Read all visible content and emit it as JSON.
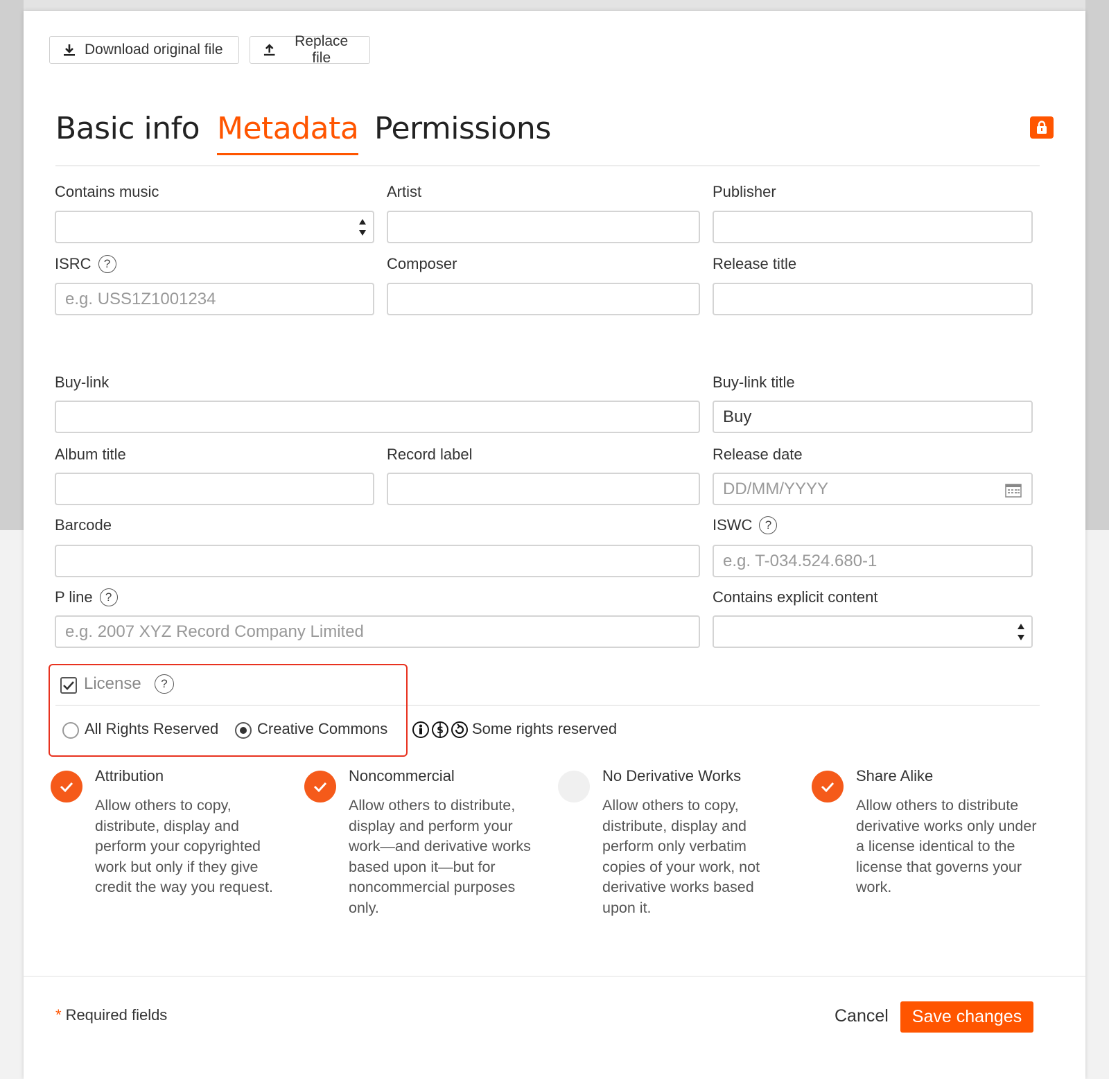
{
  "top_buttons": {
    "download": "Download original file",
    "replace": "Replace file"
  },
  "tabs": [
    {
      "label": "Basic info",
      "active": false
    },
    {
      "label": "Metadata",
      "active": true
    },
    {
      "label": "Permissions",
      "active": false
    }
  ],
  "fields": {
    "contains_music": {
      "label": "Contains music",
      "value": ""
    },
    "artist": {
      "label": "Artist",
      "value": ""
    },
    "publisher": {
      "label": "Publisher",
      "value": ""
    },
    "isrc": {
      "label": "ISRC",
      "help": "?",
      "placeholder": "e.g. USS1Z1001234",
      "value": ""
    },
    "composer": {
      "label": "Composer",
      "value": ""
    },
    "release_title": {
      "label": "Release title",
      "value": ""
    },
    "buy_link": {
      "label": "Buy-link",
      "value": ""
    },
    "buy_link_title": {
      "label": "Buy-link title",
      "value": "Buy"
    },
    "album_title": {
      "label": "Album title",
      "value": ""
    },
    "record_label": {
      "label": "Record label",
      "value": ""
    },
    "release_date": {
      "label": "Release date",
      "placeholder": "DD/MM/YYYY",
      "value": ""
    },
    "barcode": {
      "label": "Barcode",
      "value": ""
    },
    "iswc": {
      "label": "ISWC",
      "help": "?",
      "placeholder": "e.g. T-034.524.680-1",
      "value": ""
    },
    "p_line": {
      "label": "P line",
      "help": "?",
      "placeholder": "e.g. 2007 XYZ Record Company Limited",
      "value": ""
    },
    "explicit": {
      "label": "Contains explicit content",
      "value": ""
    }
  },
  "license": {
    "label": "License",
    "help": "?",
    "checked": true,
    "options": [
      {
        "label": "All Rights Reserved",
        "selected": false
      },
      {
        "label": "Creative Commons",
        "selected": true
      }
    ],
    "summary": "Some rights reserved"
  },
  "permissions": [
    {
      "title": "Attribution",
      "on": true,
      "desc": "Allow others to copy, distribute, display and perform your copyrighted work but only if they give credit the way you request."
    },
    {
      "title": "Noncommercial",
      "on": true,
      "desc": "Allow others to distribute, display and perform your work—and derivative works based upon it—but for noncommercial purposes only."
    },
    {
      "title": "No Derivative Works",
      "on": false,
      "desc": "Allow others to copy, distribute, display and perform only verbatim copies of your work, not derivative works based upon it."
    },
    {
      "title": "Share Alike",
      "on": true,
      "desc": "Allow others to distribute derivative works only under a license identical to the license that governs your work."
    }
  ],
  "footer": {
    "required_star": "*",
    "required_text": "Required fields",
    "cancel": "Cancel",
    "save": "Save changes"
  },
  "colors": {
    "accent": "#ff5500",
    "highlight_border": "#e8321f"
  }
}
